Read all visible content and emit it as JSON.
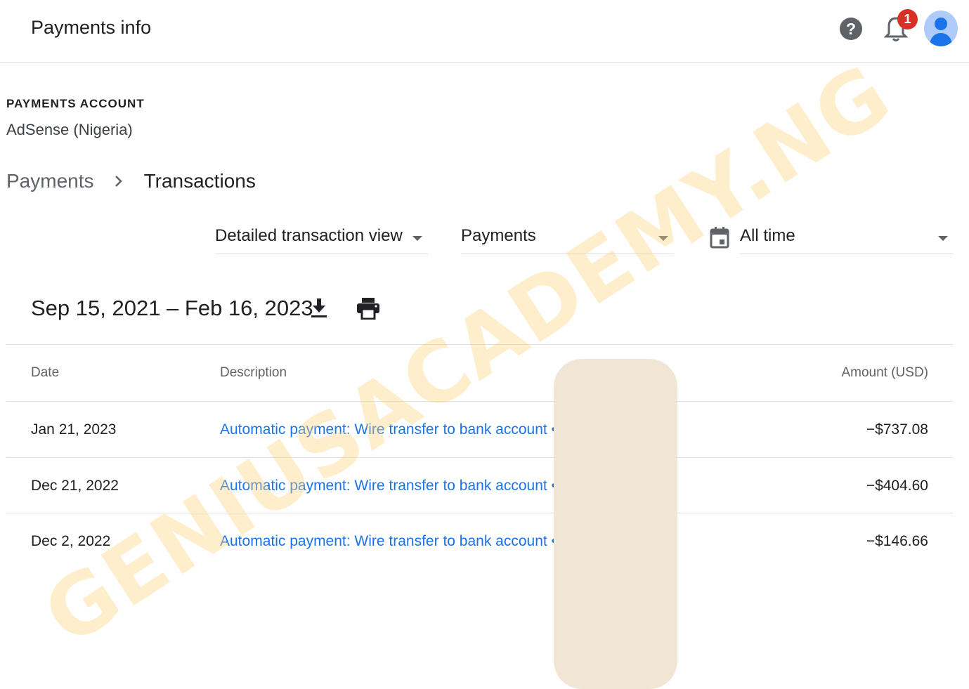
{
  "header": {
    "title": "Payments info",
    "help_icon": "help-circle-icon",
    "notifications": {
      "icon": "bell-icon",
      "badge_count": "1"
    },
    "avatar_icon": "account-avatar-icon"
  },
  "account": {
    "label": "PAYMENTS ACCOUNT",
    "name": "AdSense (Nigeria)"
  },
  "breadcrumb": {
    "parent": "Payments",
    "separator_icon": "chevron-right-icon",
    "current": "Transactions"
  },
  "filters": {
    "view": "Detailed transaction view",
    "type": "Payments",
    "period_icon": "calendar-icon",
    "period": "All time"
  },
  "range": {
    "label": "Sep 15, 2021 – Feb 16, 2023",
    "download_icon": "download-icon",
    "print_icon": "print-icon"
  },
  "table": {
    "headers": {
      "date": "Date",
      "description": "Description",
      "amount": "Amount (USD)"
    },
    "rows": [
      {
        "date": "Jan 21, 2023",
        "description": "Automatic payment: Wire transfer to bank account ••••0",
        "amount": "−$737.08"
      },
      {
        "date": "Dec 21, 2022",
        "description": "Automatic payment: Wire transfer to bank account ••••0",
        "amount": "−$404.60"
      },
      {
        "date": "Dec 2, 2022",
        "description": "Automatic payment: Wire transfer to bank account ••••0",
        "amount": "−$146.66"
      }
    ]
  },
  "watermark": "GENIUSACADEMY.NG",
  "colors": {
    "link": "#1a73e8",
    "badge": "#d93025",
    "avatar_bg": "#aecbfa",
    "avatar_fg": "#1a73e8",
    "redaction": "#f1e5d6",
    "watermark": "#ffd278"
  }
}
